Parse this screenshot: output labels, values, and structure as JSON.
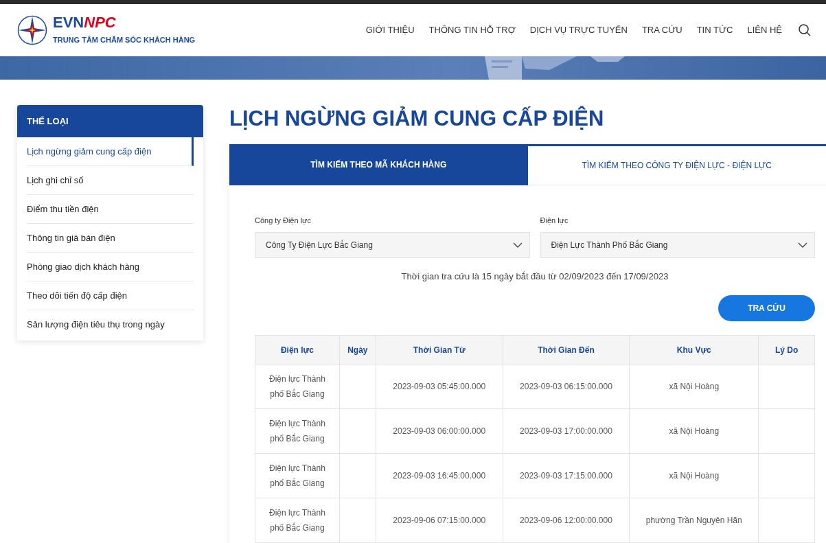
{
  "header": {
    "logo_text": "EVN",
    "logo_text_accent": "NPC",
    "tagline": "TRUNG TÂM CHĂM SÓC KHÁCH HÀNG",
    "nav": [
      "GIỚI THIỆU",
      "THÔNG TIN HỖ TRỢ",
      "DỊCH VỤ TRỰC TUYẾN",
      "TRA CỨU",
      "TIN TỨC",
      "LIÊN HỆ"
    ]
  },
  "sidebar": {
    "title": "THỂ LOẠI",
    "items": [
      {
        "label": "Lịch ngừng giảm cung cấp điện",
        "selected": true
      },
      {
        "label": "Lịch ghi chỉ số",
        "selected": false
      },
      {
        "label": "Điểm thu tiền điện",
        "selected": false
      },
      {
        "label": "Thông tin giá bán điện",
        "selected": false
      },
      {
        "label": "Phòng giao dịch khách hàng",
        "selected": false
      },
      {
        "label": "Theo dõi tiến độ cấp điện",
        "selected": false
      },
      {
        "label": "Sản lượng điện tiêu thụ trong ngày",
        "selected": false
      }
    ]
  },
  "page_title": "LỊCH NGỪNG GIẢM CUNG CẤP ĐIỆN",
  "tabs": [
    {
      "label": "TÌM KIẾM THEO MÃ KHÁCH HÀNG",
      "selected": true
    },
    {
      "label": "TÌM KIẾM THEO CÔNG TY ĐIỆN LỰC - ĐIỆN LỰC",
      "selected": false
    }
  ],
  "filters": [
    {
      "label": "Công ty Điện lực",
      "value": "Công Ty Điện Lực Bắc Giang"
    },
    {
      "label": "Điện lực",
      "value": "Điện Lực Thành Phố Bắc Giang"
    }
  ],
  "note": "Thời gian tra cứu là 15 ngày bắt đầu từ 02/09/2023 đến 17/09/2023",
  "search_button": "TRA CỨU",
  "table": {
    "columns": [
      "Điện lực",
      "Ngày",
      "Thời Gian Từ",
      "Thời Gian Đến",
      "Khu Vực",
      "Lý Do"
    ],
    "rows": [
      [
        "Điện lực Thành phố Bắc Giang",
        "",
        "2023-09-03 05:45:00.000",
        "2023-09-03 06:15:00.000",
        "xã Nội Hoàng",
        ""
      ],
      [
        "Điện lực Thành phố Bắc Giang",
        "",
        "2023-09-03 06:00:00.000",
        "2023-09-03 17:00:00.000",
        "xã Nội Hoàng",
        ""
      ],
      [
        "Điện lực Thành phố Bắc Giang",
        "",
        "2023-09-03 16:45:00.000",
        "2023-09-03 17:15:00.000",
        "xã Nội Hoàng",
        ""
      ],
      [
        "Điện lực Thành phố Bắc Giang",
        "",
        "2023-09-06 07:15:00.000",
        "2023-09-06 12:00:00.000",
        "phường Trần Nguyên Hãn",
        ""
      ]
    ]
  }
}
